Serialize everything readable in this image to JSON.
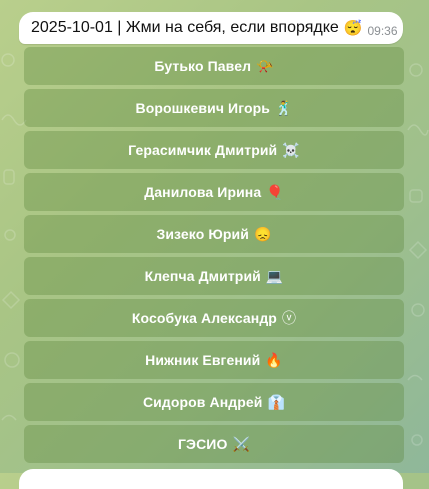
{
  "message": {
    "text": "2025-10-01 | Жми на себя, если впорядке",
    "emoji": "😴",
    "time": "09:36"
  },
  "keyboard": [
    {
      "name": "Бутько Павел",
      "emoji": "📯"
    },
    {
      "name": "Ворошкевич Игорь",
      "emoji": "🕺"
    },
    {
      "name": "Герасимчик Дмитрий",
      "emoji": "☠️"
    },
    {
      "name": "Данилова Ирина",
      "emoji": "🎈"
    },
    {
      "name": "Зизеко Юрий",
      "emoji": "😞"
    },
    {
      "name": "Клепча Дмитрий",
      "emoji": "💻"
    },
    {
      "name": "Кособука Александр",
      "emoji": "ⓥ"
    },
    {
      "name": "Нижник Евгений",
      "emoji": "🔥"
    },
    {
      "name": "Сидоров Андрей",
      "emoji": "👔"
    },
    {
      "name": "ГЭСИО",
      "emoji": "⚔️"
    }
  ]
}
